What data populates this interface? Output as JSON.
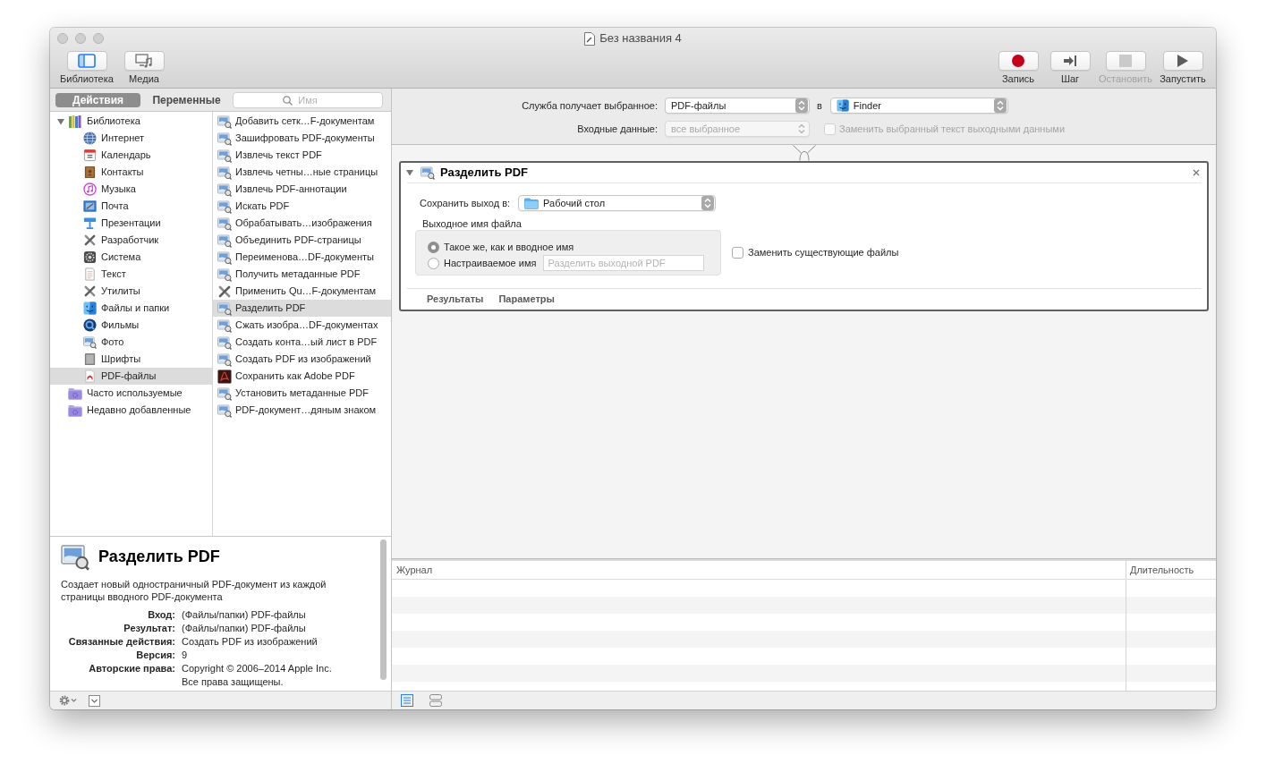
{
  "window": {
    "title": "Без названия 4"
  },
  "toolbar": {
    "left": [
      {
        "label": "Библиотека",
        "on": true
      },
      {
        "label": "Медиа",
        "on": false
      }
    ],
    "right": [
      {
        "label": "Запись",
        "disabled": false
      },
      {
        "label": "Шаг",
        "disabled": false
      },
      {
        "label": "Остановить",
        "disabled": true
      },
      {
        "label": "Запустить",
        "disabled": false
      }
    ]
  },
  "library": {
    "tabs": [
      {
        "label": "Действия",
        "selected": true
      },
      {
        "label": "Переменные",
        "selected": false
      }
    ],
    "search": {
      "placeholder": "Имя"
    },
    "categories": [
      {
        "label": "Библиотека",
        "expanded": true,
        "selected": false,
        "children": [
          {
            "label": "Интернет",
            "selected": false
          },
          {
            "label": "Календарь",
            "selected": false
          },
          {
            "label": "Контакты",
            "selected": false
          },
          {
            "label": "Музыка",
            "selected": false
          },
          {
            "label": "Почта",
            "selected": false
          },
          {
            "label": "Презентации",
            "selected": false
          },
          {
            "label": "Разработчик",
            "selected": false
          },
          {
            "label": "Система",
            "selected": false
          },
          {
            "label": "Текст",
            "selected": false
          },
          {
            "label": "Утилиты",
            "selected": false
          },
          {
            "label": "Файлы и папки",
            "selected": false
          },
          {
            "label": "Фильмы",
            "selected": false
          },
          {
            "label": "Фото",
            "selected": false
          },
          {
            "label": "Шрифты",
            "selected": false
          },
          {
            "label": "PDF-файлы",
            "selected": true
          }
        ]
      },
      {
        "label": "Часто используемые",
        "selected": false
      },
      {
        "label": "Недавно добавленные",
        "selected": false
      }
    ],
    "actions": [
      {
        "label": "Добавить сетк…F-документам",
        "selected": false
      },
      {
        "label": "Зашифровать PDF-документы",
        "selected": false
      },
      {
        "label": "Извлечь текст PDF",
        "selected": false
      },
      {
        "label": "Извлечь четны…ные страницы",
        "selected": false
      },
      {
        "label": "Извлечь PDF-аннотации",
        "selected": false
      },
      {
        "label": "Искать PDF",
        "selected": false
      },
      {
        "label": "Обрабатывать…изображения",
        "selected": false
      },
      {
        "label": "Объединить PDF-страницы",
        "selected": false
      },
      {
        "label": "Переименова…DF-документы",
        "selected": false
      },
      {
        "label": "Получить метаданные PDF",
        "selected": false
      },
      {
        "label": "Применить Qu…F-документам",
        "selected": false
      },
      {
        "label": "Разделить PDF",
        "selected": true
      },
      {
        "label": "Сжать изобра…DF-документах",
        "selected": false
      },
      {
        "label": "Создать конта…ый лист в PDF",
        "selected": false
      },
      {
        "label": "Создать PDF из изображений",
        "selected": false
      },
      {
        "label": "Сохранить как Adobe PDF",
        "selected": false
      },
      {
        "label": "Установить метаданные PDF",
        "selected": false
      },
      {
        "label": "PDF-документ…дяным знаком",
        "selected": false
      }
    ]
  },
  "description": {
    "title": "Разделить PDF",
    "text": "Создает новый одностраничный PDF-документ из каждой страницы вводного PDF-документа",
    "details": [
      {
        "label": "Вход:",
        "value": "(Файлы/папки) PDF-файлы"
      },
      {
        "label": "Результат:",
        "value": "(Файлы/папки) PDF-файлы"
      },
      {
        "label": "Связанные действия:",
        "value": "Создать PDF из изображений"
      },
      {
        "label": "Версия:",
        "value": "9"
      },
      {
        "label": "Авторские права:",
        "value": "Copyright © 2006–2014 Apple Inc.\nВсе права защищены."
      }
    ]
  },
  "service": {
    "receives": {
      "label": "Служба получает выбранное:",
      "value": "PDF-файлы"
    },
    "target": {
      "label": "в",
      "value": "Finder"
    },
    "input": {
      "label": "Входные данные:",
      "value": "все выбранное",
      "disabled": true
    },
    "replace_selected_text": {
      "label": "Заменить выбранный текст выходными данными",
      "checked": false,
      "disabled": true
    }
  },
  "workflow": {
    "actions": [
      {
        "title": "Разделить PDF",
        "expanded": true,
        "selected": true,
        "save_to": {
          "label": "Сохранить выход в:",
          "value": "Рабочий стол"
        },
        "filename": {
          "label": "Выходное имя файла",
          "options": [
            {
              "label": "Такое же, как и вводное имя",
              "selected": true
            },
            {
              "label": "Настраиваемое имя",
              "selected": false,
              "field": {
                "placeholder": "Разделить выходной PDF"
              }
            }
          ]
        },
        "replace_existing": {
          "label": "Заменить существующие файлы",
          "checked": false
        },
        "footer_tabs": [
          "Результаты",
          "Параметры"
        ]
      }
    ]
  },
  "log": {
    "columns": [
      "Журнал",
      "Длительность"
    ],
    "view_buttons": [
      {
        "selected": true
      },
      {
        "selected": false
      }
    ]
  }
}
